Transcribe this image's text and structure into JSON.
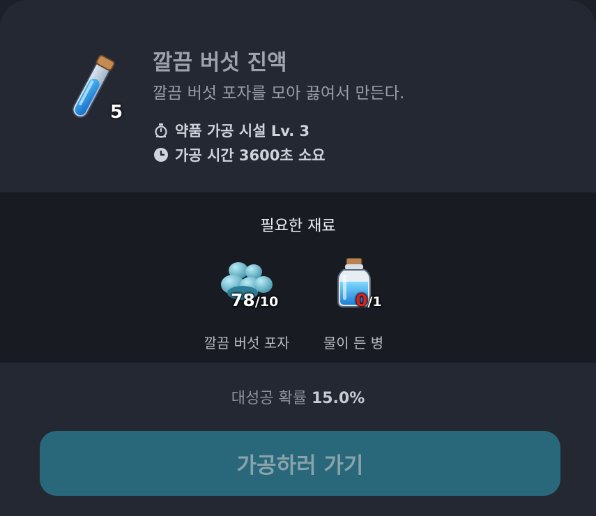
{
  "item": {
    "name": "깔끔 버섯 진액",
    "description": "깔끔 버섯 포자를 모아 끓여서 만든다.",
    "count": "5",
    "icon": "blue-potion-vial-icon",
    "facility": "약품 가공 시설 Lv. 3",
    "time": "가공 시간 3600초 소요"
  },
  "materials": {
    "title": "필요한 재료",
    "items": [
      {
        "name": "깔끔 버섯 포자",
        "have": "78",
        "need": "/10",
        "icon": "mushroom-spores-icon",
        "have_color": "#ffffff"
      },
      {
        "name": "물이 든 병",
        "have": "0",
        "need": "/1",
        "icon": "water-bottle-icon",
        "have_color": "#e0201c"
      }
    ]
  },
  "crit": {
    "label": "대성공 확률",
    "value": "15.0%"
  },
  "action": {
    "label": "가공하러 가기"
  }
}
